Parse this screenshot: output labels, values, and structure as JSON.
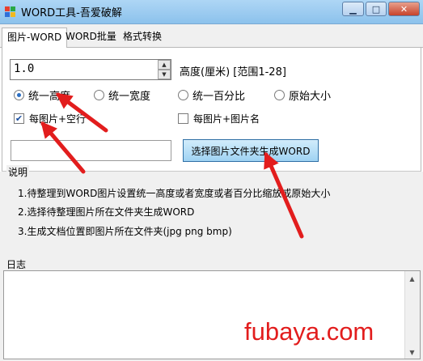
{
  "window": {
    "title": "WORD工具-吾爱破解",
    "min_glyph": "▁",
    "max_glyph": "□",
    "close_glyph": "✕"
  },
  "tabs": [
    {
      "label": "图片-WORD",
      "active": true
    },
    {
      "label": "WORD批量",
      "active": false
    },
    {
      "label": "格式转换",
      "active": false
    }
  ],
  "form": {
    "size_value": "1.0",
    "spin_up": "▲",
    "spin_down": "▼",
    "height_label": "高度(厘米) [范围1-28]",
    "radios": [
      {
        "label": "统一高度",
        "checked": true
      },
      {
        "label": "统一宽度",
        "checked": false
      },
      {
        "label": "统一百分比",
        "checked": false
      },
      {
        "label": "原始大小",
        "checked": false
      }
    ],
    "checks": [
      {
        "label": "每图片+空行",
        "checked": true,
        "mark": "✔"
      },
      {
        "label": "每图片+图片名",
        "checked": false,
        "mark": ""
      }
    ],
    "folder_path": "",
    "generate_button": "选择图片文件夹生成WORD"
  },
  "description": {
    "title": "说明",
    "items": [
      "1.待整理到WORD图片设置统一高度或者宽度或者百分比缩放或原始大小",
      "2.选择待整理图片所在文件夹生成WORD",
      "3.生成文档位置即图片所在文件夹(jpg png bmp)"
    ]
  },
  "log": {
    "title": "日志",
    "content": "",
    "up": "▲",
    "down": "▼"
  },
  "watermark": "fubaya.com",
  "colors": {
    "accent": "#2b6fc4",
    "annotation": "#e21d1d",
    "titlebar": "#9cccf0"
  }
}
